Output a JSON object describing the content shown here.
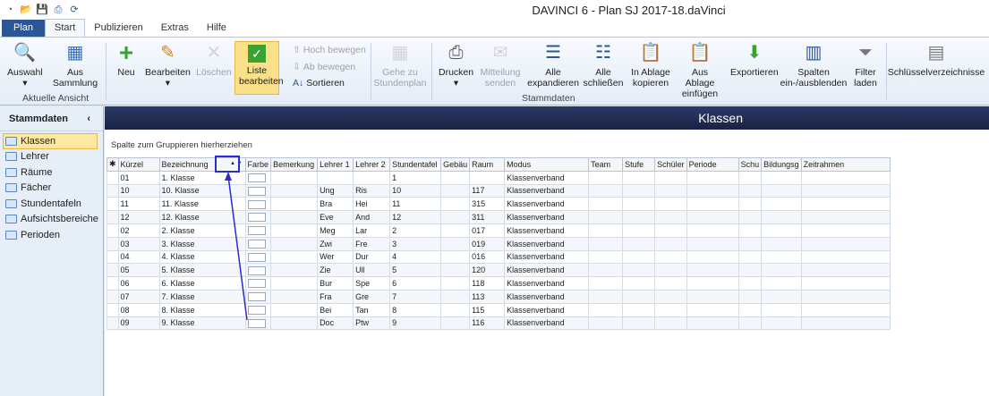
{
  "app": {
    "title": "DAVINCI 6 - Plan SJ 2017-18.daVinci"
  },
  "tabs": [
    "Plan",
    "Start",
    "Publizieren",
    "Extras",
    "Hilfe"
  ],
  "ribbon": {
    "auswahl": "Auswahl",
    "aus_sammlung": "Aus Sammlung",
    "aktuelle_ansicht": "Aktuelle Ansicht",
    "neu": "Neu",
    "bearbeiten": "Bearbeiten",
    "loeschen": "Löschen",
    "liste_bearbeiten": "Liste bearbeiten",
    "hoch": "Hoch bewegen",
    "ab": "Ab bewegen",
    "sortieren": "Sortieren",
    "gehe": "Gehe zu Stundenplan",
    "drucken": "Drucken",
    "mitteilung": "Mitteilung senden",
    "expandieren": "Alle expandieren",
    "schliessen": "Alle schließen",
    "ablage_kopieren": "In Ablage kopieren",
    "ablage_einfuegen": "Aus Ablage einfügen",
    "exportieren": "Exportieren",
    "spalten": "Spalten ein-/ausblenden",
    "filter": "Filter laden",
    "schluessel": "Schlüsselverzeichnisse",
    "stammdaten": "Stammdaten"
  },
  "sidebar": {
    "title": "Stammdaten",
    "items": [
      "Klassen",
      "Lehrer",
      "Räume",
      "Fächer",
      "Stundentafeln",
      "Aufsichtsbereiche",
      "Perioden"
    ]
  },
  "main": {
    "title": "Klassen",
    "group_hint": "Spalte zum Gruppieren hierherziehen"
  },
  "columns": [
    "Kürzel",
    "Bezeichnung",
    "Farbe",
    "Bemerkung",
    "Lehrer 1",
    "Lehrer 2",
    "Stundentafel",
    "Gebäu",
    "Raum",
    "Modus",
    "Team",
    "Stufe",
    "Schüler",
    "Periode",
    "Schu",
    "Bildungsg",
    "Zeitrahmen"
  ],
  "rows": [
    [
      "01",
      "1. Klasse",
      "",
      "",
      "",
      "",
      "1",
      "",
      "",
      "Klassenverband"
    ],
    [
      "10",
      "10. Klasse",
      "",
      "",
      "Ung",
      "Ris",
      "10",
      "",
      "117",
      "Klassenverband"
    ],
    [
      "11",
      "11. Klasse",
      "",
      "",
      "Bra",
      "Hei",
      "11",
      "",
      "315",
      "Klassenverband"
    ],
    [
      "12",
      "12. Klasse",
      "",
      "",
      "Eve",
      "And",
      "12",
      "",
      "311",
      "Klassenverband"
    ],
    [
      "02",
      "2. Klasse",
      "",
      "",
      "Meg",
      "Lar",
      "2",
      "",
      "017",
      "Klassenverband"
    ],
    [
      "03",
      "3. Klasse",
      "",
      "",
      "Zwi",
      "Fre",
      "3",
      "",
      "019",
      "Klassenverband"
    ],
    [
      "04",
      "4. Klasse",
      "",
      "",
      "Wer",
      "Dur",
      "4",
      "",
      "016",
      "Klassenverband"
    ],
    [
      "05",
      "5. Klasse",
      "",
      "",
      "Zie",
      "Ull",
      "5",
      "",
      "120",
      "Klassenverband"
    ],
    [
      "06",
      "6. Klasse",
      "",
      "",
      "Bur",
      "Spe",
      "6",
      "",
      "118",
      "Klassenverband"
    ],
    [
      "07",
      "7. Klasse",
      "",
      "",
      "Fra",
      "Gre",
      "7",
      "",
      "113",
      "Klassenverband"
    ],
    [
      "08",
      "8. Klasse",
      "",
      "",
      "Bei",
      "Tan",
      "8",
      "",
      "115",
      "Klassenverband"
    ],
    [
      "09",
      "9. Klasse",
      "",
      "",
      "Doc",
      "Ptw",
      "9",
      "",
      "116",
      "Klassenverband"
    ]
  ],
  "colors": {
    "accent": "#2b5797",
    "highlight": "#fbe08a",
    "annotation": "#2b2bd0"
  }
}
